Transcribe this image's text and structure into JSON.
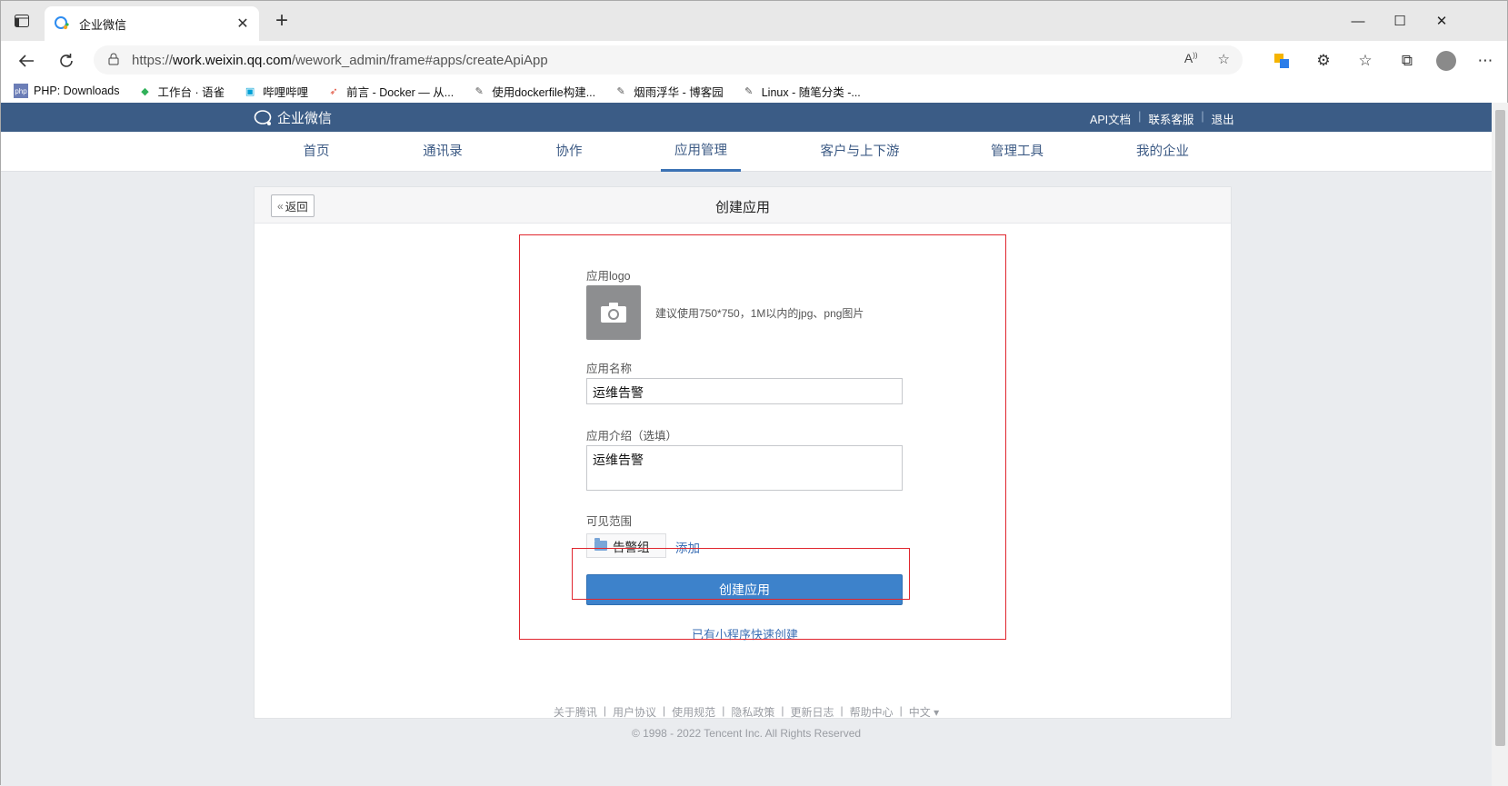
{
  "browser": {
    "tab_title": "企业微信",
    "url_prefix": "https://",
    "url_host": "work.weixin.qq.com",
    "url_path": "/wework_admin/frame#apps/createApiApp",
    "bookmarks": [
      {
        "label": "PHP: Downloads",
        "icon": "php-icon"
      },
      {
        "label": "工作台 · 语雀",
        "icon": "yuque-icon"
      },
      {
        "label": "哔哩哔哩",
        "icon": "bilibili-icon"
      },
      {
        "label": "前言 - Docker — 从...",
        "icon": "rocket-icon"
      },
      {
        "label": "使用dockerfile构建...",
        "icon": "cnblogs-icon"
      },
      {
        "label": "烟雨浮华 - 博客园",
        "icon": "cnblogs-icon"
      },
      {
        "label": "Linux - 随笔分类 -...",
        "icon": "cnblogs-icon"
      }
    ]
  },
  "header": {
    "brand": "企业微信",
    "links": [
      "API文档",
      "联系客服",
      "退出"
    ]
  },
  "nav": {
    "items": [
      "首页",
      "通讯录",
      "协作",
      "应用管理",
      "客户与上下游",
      "管理工具",
      "我的企业"
    ],
    "active": "应用管理"
  },
  "card": {
    "back_label": "返回",
    "title": "创建应用"
  },
  "form": {
    "logo_label": "应用logo",
    "logo_hint": "建议使用750*750，1M以内的jpg、png图片",
    "name_label": "应用名称",
    "name_value": "运维告警",
    "intro_label": "应用介绍（选填）",
    "intro_value": "运维告警",
    "scope_label": "可见范围",
    "scope_tag": "告警组",
    "add_label": "添加",
    "create_label": "创建应用",
    "quick_create": "已有小程序快速创建"
  },
  "footer": {
    "links": [
      "关于腾讯",
      "用户协议",
      "使用规范",
      "隐私政策",
      "更新日志",
      "帮助中心",
      "中文 ▾"
    ],
    "copyright": "© 1998 - 2022 Tencent Inc. All Rights Reserved"
  },
  "colors": {
    "topbar": "#3b5c86",
    "primary_button": "#3d82cb",
    "highlight_box": "#e0262e"
  }
}
